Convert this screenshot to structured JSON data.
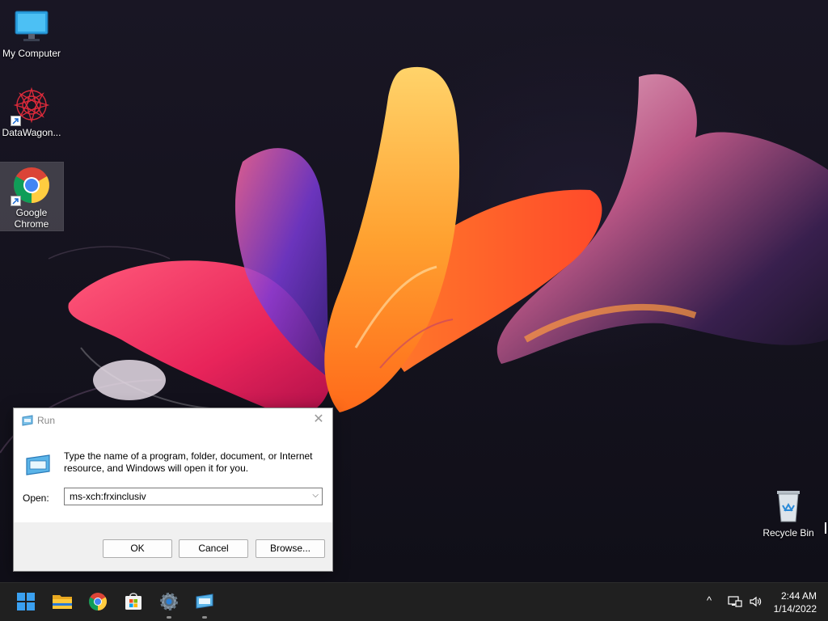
{
  "desktop_icons": [
    {
      "label": "My Computer",
      "icon": "monitor-icon"
    },
    {
      "label": "DataWagon...",
      "icon": "datawagon-icon"
    },
    {
      "label": "Google Chrome",
      "icon": "chrome-icon",
      "selected": true
    },
    {
      "label": "Recycle Bin",
      "icon": "recycle-bin-icon"
    }
  ],
  "run_dialog": {
    "title": "Run",
    "close_glyph": "✕",
    "description": "Type the name of a program, folder, document, or Internet resource, and Windows will open it for you.",
    "open_label": "Open:",
    "open_value": "ms-xch:frxinclusiv",
    "dropdown_glyph": "⌵",
    "buttons": {
      "ok": "OK",
      "cancel": "Cancel",
      "browse": "Browse..."
    }
  },
  "taskbar": {
    "apps": [
      {
        "name": "start-button",
        "icon": "windows-logo-icon"
      },
      {
        "name": "file-explorer-button",
        "icon": "folder-icon"
      },
      {
        "name": "chrome-taskbar-button",
        "icon": "chrome-icon"
      },
      {
        "name": "store-button",
        "icon": "store-bag-icon"
      },
      {
        "name": "settings-button",
        "icon": "gear-icon",
        "running": true
      },
      {
        "name": "run-taskbar-button",
        "icon": "run-icon",
        "running": true
      }
    ],
    "tray": {
      "chevron": "^",
      "network_icon": "network-icon",
      "volume_icon": "volume-icon"
    },
    "clock": {
      "time": "2:44 AM",
      "date": "1/14/2022"
    }
  },
  "colors": {
    "taskbar": "#202020",
    "accent": "#0078d4",
    "dialog_bg": "#f0f0f0"
  }
}
